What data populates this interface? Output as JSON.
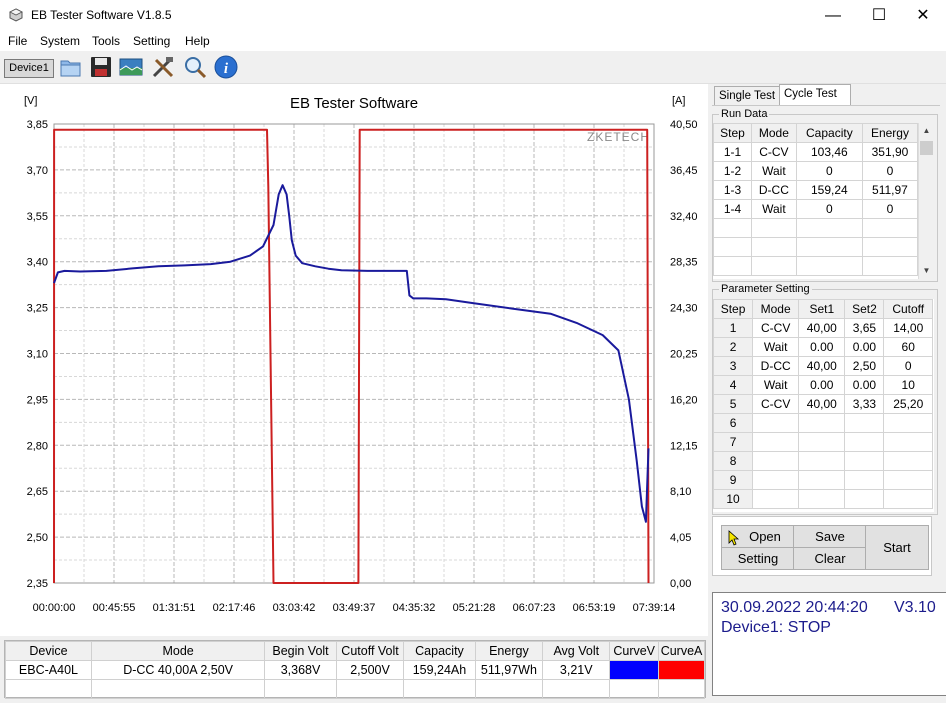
{
  "window": {
    "title": "EB Tester Software V1.8.5",
    "minimize_icon": "minimize-icon",
    "maximize_icon": "maximize-icon",
    "close_icon": "close-icon",
    "minimize_glyph": "—",
    "maximize_glyph": "☐",
    "close_glyph": "✕"
  },
  "menu": [
    "File",
    "System",
    "Tools",
    "Setting",
    "Help"
  ],
  "toolbar": {
    "device_tab": "Device1",
    "icons": [
      "open-folder-icon",
      "save-icon",
      "picture-icon",
      "tools-icon",
      "zoom-icon",
      "info-icon"
    ]
  },
  "chart_data": {
    "type": "line",
    "title": "EB Tester Software",
    "watermark": "ZKETECH",
    "y_left_label": "[V]",
    "y_right_label": "[A]",
    "y_left_ticks": [
      "3,85",
      "3,70",
      "3,55",
      "3,40",
      "3,25",
      "3,10",
      "2,95",
      "2,80",
      "2,65",
      "2,50",
      "2,35"
    ],
    "y_right_ticks": [
      "40,50",
      "36,45",
      "32,40",
      "28,35",
      "24,30",
      "20,25",
      "16,20",
      "12,15",
      "8,10",
      "4,05",
      "0,00"
    ],
    "x_ticks": [
      "00:00:00",
      "00:45:55",
      "01:31:51",
      "02:17:46",
      "03:03:42",
      "03:49:37",
      "04:35:32",
      "05:21:28",
      "06:07:23",
      "06:53:19",
      "07:39:14"
    ],
    "ylim_left": [
      2.35,
      3.85
    ],
    "ylim_right": [
      0,
      40.5
    ],
    "xlim_minutes": [
      0,
      459.23
    ],
    "grid": true,
    "series": [
      {
        "color": "#1a1a9c",
        "axis": "left",
        "x": [
          0,
          3,
          8,
          20,
          40,
          60,
          80,
          100,
          120,
          135,
          150,
          160,
          168,
          172,
          175,
          178,
          180,
          182,
          185,
          190,
          200,
          210,
          220,
          240,
          270,
          271,
          272,
          275,
          285,
          300,
          320,
          350,
          380,
          400,
          420,
          432,
          440,
          446,
          450,
          453,
          455
        ],
        "values": [
          3.33,
          3.365,
          3.37,
          3.368,
          3.37,
          3.378,
          3.385,
          3.388,
          3.392,
          3.4,
          3.42,
          3.45,
          3.52,
          3.62,
          3.65,
          3.62,
          3.55,
          3.47,
          3.42,
          3.395,
          3.385,
          3.377,
          3.372,
          3.37,
          3.37,
          3.33,
          3.29,
          3.28,
          3.28,
          3.277,
          3.265,
          3.247,
          3.23,
          3.2,
          3.16,
          3.11,
          2.95,
          2.75,
          2.6,
          2.55,
          2.79
        ]
      },
      {
        "color": "#cc2020",
        "axis": "right",
        "x": [
          0,
          0.1,
          163,
          164,
          168,
          169,
          233,
          234,
          454,
          455
        ],
        "values": [
          0,
          40,
          40,
          35,
          0,
          0,
          0,
          40,
          40,
          0
        ]
      }
    ]
  },
  "tabs": [
    "Single Test",
    "Cycle Test"
  ],
  "run_data": {
    "legend": "Run Data",
    "headers": [
      "Step",
      "Mode",
      "Capacity",
      "Energy"
    ],
    "rows": [
      [
        "1-1",
        "C-CV",
        "103,46",
        "351,90"
      ],
      [
        "1-2",
        "Wait",
        "0",
        "0"
      ],
      [
        "1-3",
        "D-CC",
        "159,24",
        "511,97"
      ],
      [
        "1-4",
        "Wait",
        "0",
        "0"
      ]
    ]
  },
  "parameter_setting": {
    "legend": "Parameter Setting",
    "headers": [
      "Step",
      "Mode",
      "Set1",
      "Set2",
      "Cutoff"
    ],
    "rows": [
      [
        "1",
        "C-CV",
        "40,00",
        "3,65",
        "14,00"
      ],
      [
        "2",
        "Wait",
        "0.00",
        "0.00",
        "60"
      ],
      [
        "3",
        "D-CC",
        "40,00",
        "2,50",
        "0"
      ],
      [
        "4",
        "Wait",
        "0.00",
        "0.00",
        "10"
      ],
      [
        "5",
        "C-CV",
        "40,00",
        "3,33",
        "25,20"
      ],
      [
        "6",
        "",
        "",
        "",
        ""
      ],
      [
        "7",
        "",
        "",
        "",
        ""
      ],
      [
        "8",
        "",
        "",
        "",
        ""
      ],
      [
        "9",
        "",
        "",
        "",
        ""
      ],
      [
        "10",
        "",
        "",
        "",
        ""
      ]
    ]
  },
  "buttons": {
    "open": "Open",
    "save": "Save",
    "setting": "Setting",
    "clear": "Clear",
    "start": "Start"
  },
  "status": {
    "datetime": "30.09.2022 20:44:20",
    "version": "V3.10",
    "device_state": "Device1: STOP"
  },
  "results": {
    "headers": [
      "Device",
      "Mode",
      "Begin Volt",
      "Cutoff Volt",
      "Capacity",
      "Energy",
      "Avg Volt",
      "CurveV",
      "CurveA"
    ],
    "row": [
      "EBC-A40L",
      "D-CC  40,00A  2,50V",
      "3,368V",
      "2,500V",
      "159,24Ah",
      "511,97Wh",
      "3,21V"
    ],
    "curve_colors": [
      "#0000ff",
      "#ff0000"
    ]
  }
}
